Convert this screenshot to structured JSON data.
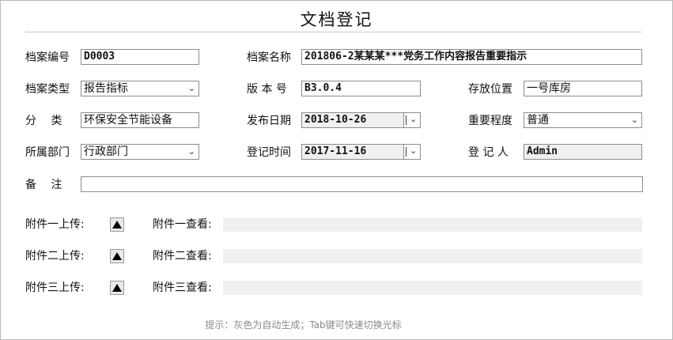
{
  "title": "文档登记",
  "fields": {
    "archive_no": {
      "label": "档案编号",
      "value": "D0003"
    },
    "archive_name": {
      "label": "档案名称",
      "value": "201806-2某某某***党务工作内容报告重要指示"
    },
    "archive_type": {
      "label": "档案类型",
      "value": "报告指标"
    },
    "version": {
      "label": "版 本 号",
      "value": "B3.0.4"
    },
    "location": {
      "label": "存放位置",
      "value": "一号库房"
    },
    "category": {
      "label": "分　 类",
      "value": "环保安全节能设备"
    },
    "publish_date": {
      "label": "发布日期",
      "value": "2018-10-26"
    },
    "importance": {
      "label": "重要程度",
      "value": "普通"
    },
    "department": {
      "label": "所属部门",
      "value": "行政部门"
    },
    "register_time": {
      "label": "登记时间",
      "value": "2017-11-16"
    },
    "registrant": {
      "label": "登 记 人",
      "value": "Admin"
    },
    "remarks": {
      "label": "备　 注",
      "value": ""
    }
  },
  "attachments": [
    {
      "upload_label": "附件一上传:",
      "view_label": "附件一查看:"
    },
    {
      "upload_label": "附件二上传:",
      "view_label": "附件二查看:"
    },
    {
      "upload_label": "附件三上传:",
      "view_label": "附件三查看:"
    }
  ],
  "hint": "提示：灰色为自动生成；Tab键可快速切换光标",
  "icons": {
    "select_caret": "chevron-down-icon",
    "upload": "upload-triangle-icon"
  }
}
